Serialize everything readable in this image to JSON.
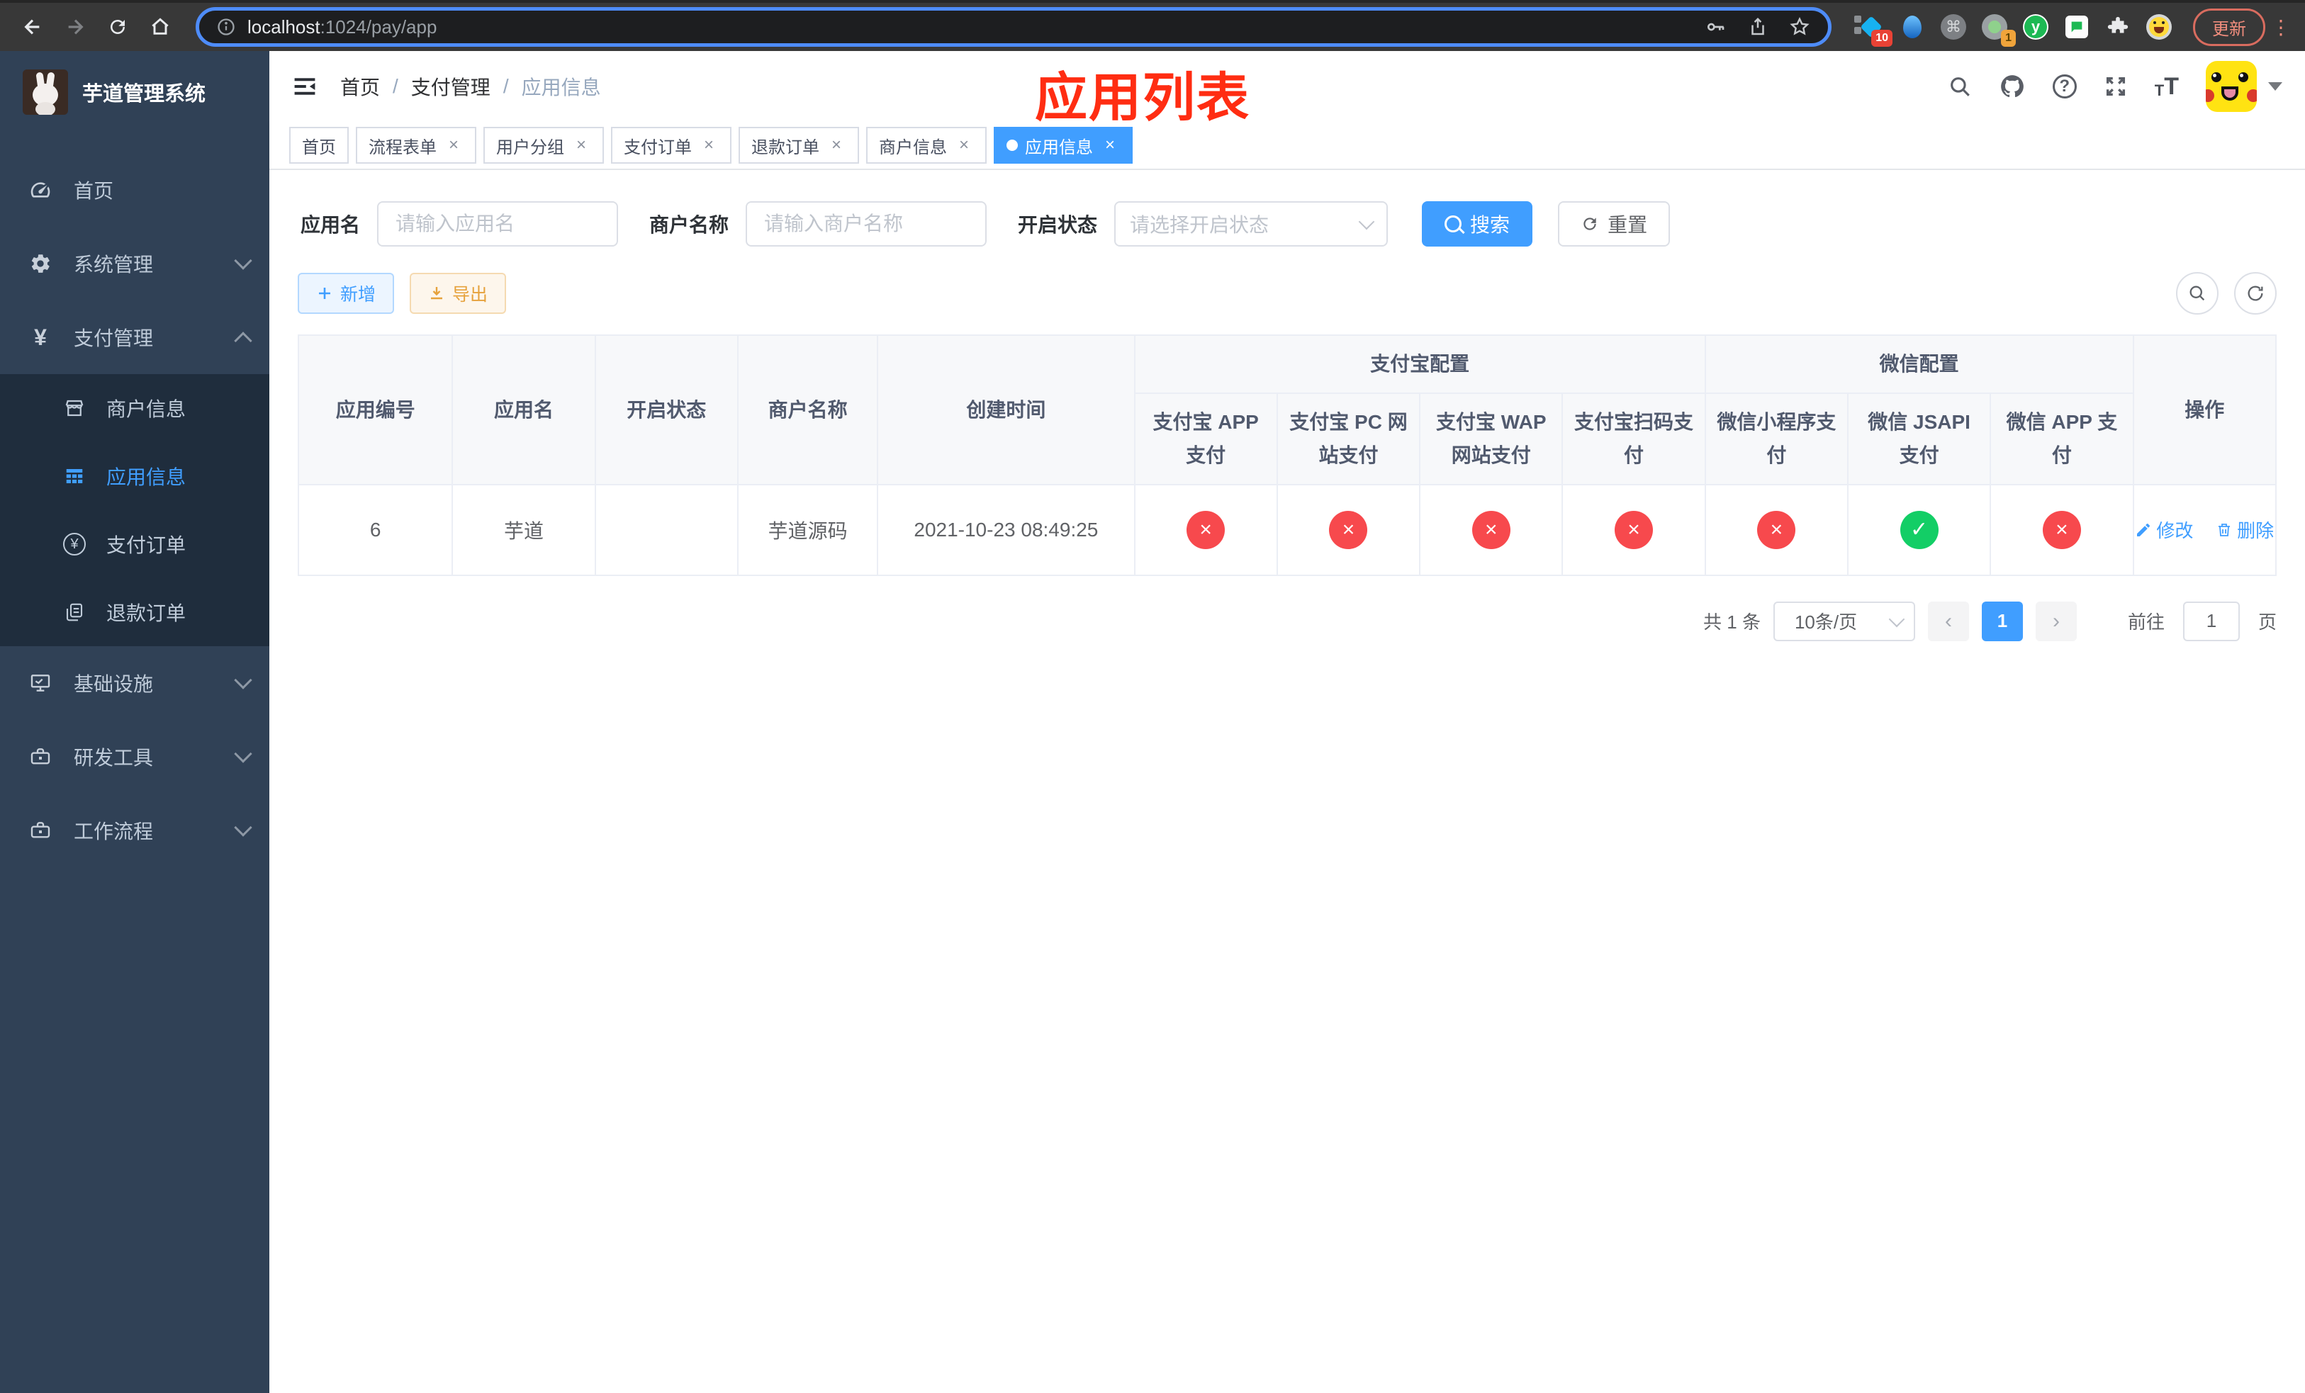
{
  "browser": {
    "url": {
      "host": "localhost",
      "path": ":1024/pay/app"
    },
    "update_button": "更新",
    "kebab_glyph": "⋮",
    "extensions": {
      "pin_badge": "10",
      "record_badge": "1",
      "cmd_glyph": "⌘",
      "y_letter": "y"
    }
  },
  "sidebar": {
    "logo_title": "芋道管理系统",
    "menu": [
      {
        "label": "首页"
      },
      {
        "label": "系统管理"
      },
      {
        "label": "支付管理"
      },
      {
        "label": "基础设施"
      },
      {
        "label": "研发工具"
      },
      {
        "label": "工作流程"
      }
    ],
    "submenu": [
      {
        "label": "商户信息"
      },
      {
        "label": "应用信息"
      },
      {
        "label": "支付订单"
      },
      {
        "label": "退款订单"
      }
    ]
  },
  "navbar": {
    "breadcrumb": {
      "items": [
        "首页",
        "支付管理",
        "应用信息"
      ],
      "separator": "/"
    },
    "annotation": "应用列表"
  },
  "tags": [
    {
      "label": "首页"
    },
    {
      "label": "流程表单"
    },
    {
      "label": "用户分组"
    },
    {
      "label": "支付订单"
    },
    {
      "label": "退款订单"
    },
    {
      "label": "商户信息"
    },
    {
      "label": "应用信息"
    }
  ],
  "search": {
    "app_name_label": "应用名",
    "app_name_placeholder": "请输入应用名",
    "merchant_label": "商户名称",
    "merchant_placeholder": "请输入商户名称",
    "status_label": "开启状态",
    "status_placeholder": "请选择开启状态",
    "search_button": "搜索",
    "reset_button": "重置"
  },
  "toolbar": {
    "add_button": "新增",
    "export_button": "导出"
  },
  "table": {
    "columns": {
      "app_id": "应用编号",
      "app_name": "应用名",
      "status": "开启状态",
      "merchant": "商户名称",
      "created": "创建时间",
      "ops": "操作"
    },
    "groups": {
      "alipay": "支付宝配置",
      "wechat": "微信配置"
    },
    "channel_columns": [
      "支付宝 APP 支付",
      "支付宝 PC 网站支付",
      "支付宝 WAP 网站支付",
      "支付宝扫码支付",
      "微信小程序支付",
      "微信 JSAPI 支付",
      "微信 APP 支付"
    ],
    "row": {
      "app_id": "6",
      "app_name": "芋道",
      "enabled": true,
      "merchant": "芋道源码",
      "created": "2021-10-23 08:49:25",
      "channels": [
        false,
        false,
        false,
        false,
        false,
        true,
        false
      ],
      "edit_label": "修改",
      "delete_label": "删除"
    }
  },
  "pagination": {
    "total": "共 1 条",
    "page_size": "10条/页",
    "current_page": "1",
    "prev_glyph": "‹",
    "next_glyph": "›",
    "goto_label": "前往",
    "goto_value": "1",
    "goto_unit": "页"
  },
  "icons": {
    "check": "✓",
    "cross": "×",
    "close": "×",
    "yen": "¥",
    "question": "?",
    "t_small": "T",
    "t_large": "T"
  },
  "colors": {
    "accent": "#409eff",
    "success": "#13ce66",
    "danger": "#f7494d",
    "warning": "#e6a23c",
    "annotation_red": "#ff2d12",
    "sidebar_bg": "#304156",
    "submenu_bg": "#1f2d3d",
    "active_tag": "#409eff"
  }
}
